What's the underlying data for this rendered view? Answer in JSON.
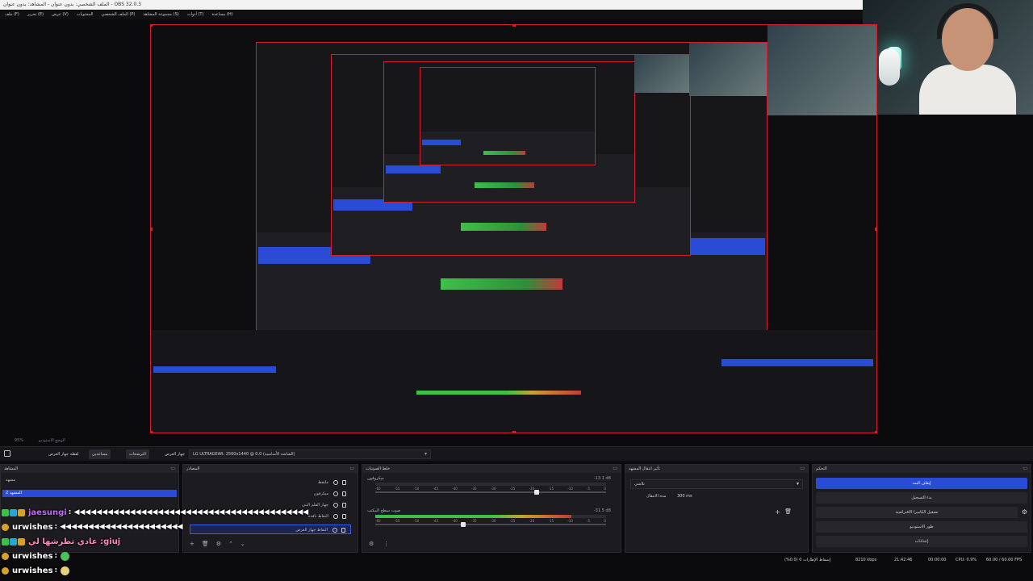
{
  "window": {
    "title": "الملف الشخصي: بدون عنوان - المشاهد: بدون عنوان - OBS 32.0.3",
    "menus": [
      "ملف (F)",
      "تحرير (E)",
      "عرض (V)",
      "المحتويات",
      "الملف الشخصي (P)",
      "مجموعة المشاهد (S)",
      "أدوات (T)",
      "مساعدة (H)"
    ]
  },
  "toolbar": {
    "fit_label": "95%",
    "studio_label": "الوضع الاستوديو",
    "buttons": [
      "مساعدين",
      "الترشحات",
      "لقطة جهاز العرض"
    ],
    "display_label": "جهاز العرض",
    "display_value": "LG ULTRAGEAR: 2560x1440 @ 0,0 (الشاشة الأساسية)"
  },
  "docks": {
    "scenes": {
      "title": "المشاهد",
      "items": [
        "مشهد",
        "المشهد 2"
      ],
      "active_index": 1
    },
    "sources": {
      "title": "المصادر",
      "items": [
        "ملتقط",
        "ميكرفون",
        "جهاز القلم البني",
        "التقاط نافذة",
        "التقاط جهاز العرض"
      ],
      "selected_index": 4
    },
    "mixer": {
      "title": "خلط الصوتيات",
      "channels": [
        {
          "name": "ميكروفون",
          "db": "-13.1 dB",
          "level": 0.0,
          "volume": 0.7
        },
        {
          "name": "صوت سطح المكتب",
          "db": "-31.5 dB",
          "level": 0.85,
          "volume": 0.38
        }
      ],
      "scale": [
        "-60",
        "-55",
        "-50",
        "-45",
        "-40",
        "-35",
        "-30",
        "-25",
        "-20",
        "-15",
        "-10",
        "-5",
        "0"
      ]
    },
    "transitions": {
      "title": "تأثير انتقال المشهد",
      "type": "تلاشي",
      "duration_label": "مدة الانتقال",
      "duration_value": "300 ms"
    },
    "controls": {
      "title": "التحكم",
      "buttons": [
        "إيقاف البث",
        "بدء التسجيل",
        "تشغيل الكاميرا الافتراضية",
        "طور الاستوديو",
        "إعدادات"
      ]
    }
  },
  "status": {
    "dropped": "إسقاط الإطارات 0 (0.0%)",
    "bitrate": "8210 kbps",
    "stream_time": "21:42:46",
    "rec_time": "00:00:00",
    "cpu": "CPU: 0.9%",
    "fps": "60.00 / 60.00 FPS"
  },
  "chat": [
    {
      "user": "jaesungi",
      "color": "#c866ff",
      "message": ": ◀◀◀◀◀◀◀◀◀◀◀◀◀◀◀◀◀◀◀◀◀◀◀◀◀◀◀◀◀◀◀◀◀◀◀◀◀◀◀◀◀◀"
    },
    {
      "user": "urwishes",
      "color": "#ffffff",
      "message": ": ◀◀◀◀◀◀◀◀◀◀◀◀◀◀◀◀◀◀◀◀◀◀"
    },
    {
      "user": "عادي تطرشها لي :giuj",
      "color": "#ff8ab4",
      "message": ""
    },
    {
      "user": "urwishes",
      "color": "#ffffff",
      "message": ":"
    },
    {
      "user": "urwishes",
      "color": "#ffffff",
      "message": ":"
    }
  ],
  "colors": {
    "accent": "#2a4bd6",
    "selection_border": "#d21f2e",
    "meter_green": "#3fbf4a",
    "meter_red": "#c23a3a"
  }
}
